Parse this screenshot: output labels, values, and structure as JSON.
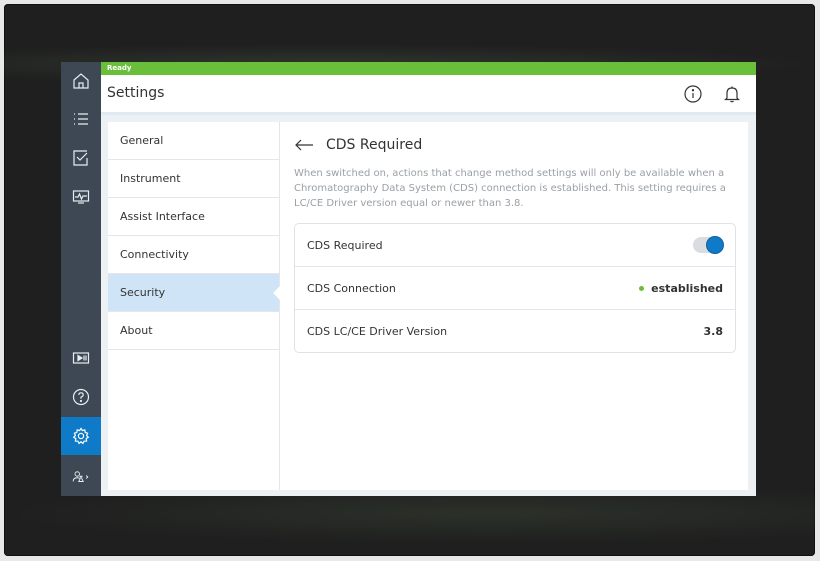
{
  "status": {
    "text": "Ready",
    "color": "#6abf3a"
  },
  "header": {
    "title": "Settings",
    "info_icon": "info-icon",
    "bell_icon": "bell-icon"
  },
  "rail": {
    "top_icons": [
      "home-icon",
      "list-icon",
      "checklist-icon",
      "monitor-chart-icon"
    ],
    "bottom_icons": [
      "media-player-icon",
      "help-icon",
      "gear-icon",
      "user-flask-icon"
    ],
    "active": "gear-icon",
    "accent": "#0e7ac8"
  },
  "menu": {
    "items": [
      {
        "label": "General"
      },
      {
        "label": "Instrument"
      },
      {
        "label": "Assist Interface"
      },
      {
        "label": "Connectivity"
      },
      {
        "label": "Security"
      },
      {
        "label": "About"
      }
    ],
    "selected": "Security"
  },
  "detail": {
    "title": "CDS Required",
    "description": "When switched on, actions that change method settings will only be available when a Chromatography Data System (CDS) connection is established. This setting requires a LC/CE Driver version equal or newer than 3.8.",
    "rows": [
      {
        "label": "CDS Required",
        "toggle_on": true
      },
      {
        "label": "CDS Connection",
        "value": "established",
        "status_color": "#6abf3a"
      },
      {
        "label": "CDS LC/CE Driver Version",
        "value": "3.8"
      }
    ]
  }
}
